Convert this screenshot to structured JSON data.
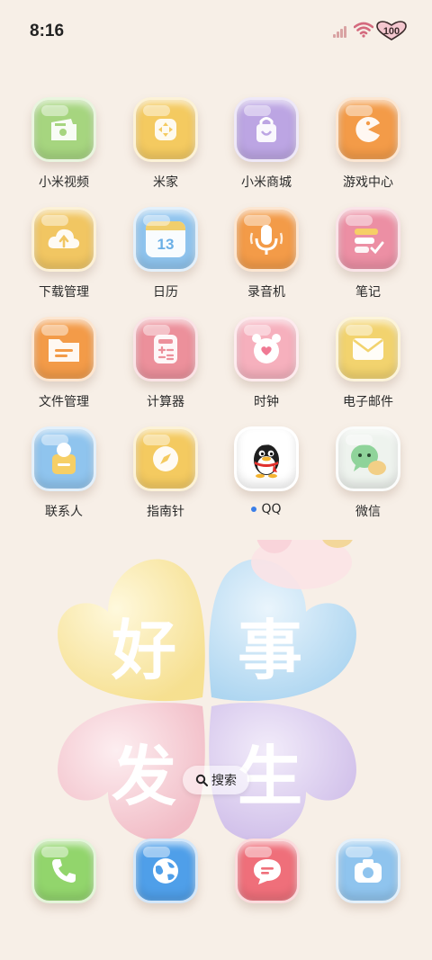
{
  "status": {
    "time": "8:16",
    "battery": "100"
  },
  "apps": [
    {
      "label": "小米视频",
      "icon": "video-icon",
      "color": "#9fd17a"
    },
    {
      "label": "米家",
      "icon": "home-hub-icon",
      "color": "#f3c75a"
    },
    {
      "label": "小米商城",
      "icon": "shopping-bag-icon",
      "color": "#b9a2e0"
    },
    {
      "label": "游戏中心",
      "icon": "game-pacman-icon",
      "color": "#f29a45"
    },
    {
      "label": "下载管理",
      "icon": "download-cloud-icon",
      "color": "#f0c560"
    },
    {
      "label": "日历",
      "icon": "calendar-icon",
      "color": "#8cc2ee",
      "calendar_day": "13"
    },
    {
      "label": "录音机",
      "icon": "microphone-icon",
      "color": "#f29a45"
    },
    {
      "label": "笔记",
      "icon": "notes-icon",
      "color": "#e98aa0"
    },
    {
      "label": "文件管理",
      "icon": "folder-icon",
      "color": "#f29a45"
    },
    {
      "label": "计算器",
      "icon": "calculator-icon",
      "color": "#ea8d98"
    },
    {
      "label": "时钟",
      "icon": "alarm-clock-icon",
      "color": "#f4a9b7"
    },
    {
      "label": "电子邮件",
      "icon": "mail-icon",
      "color": "#f1d16a"
    },
    {
      "label": "联系人",
      "icon": "contacts-icon",
      "color": "#8cc2ee"
    },
    {
      "label": "指南针",
      "icon": "compass-icon",
      "color": "#f3c75a"
    },
    {
      "label": "QQ",
      "icon": "qq-penguin-icon",
      "color": "#ffffff"
    },
    {
      "label": "微信",
      "icon": "wechat-icon",
      "color": "#eef3ee"
    }
  ],
  "wallpaper": {
    "chars": [
      "好",
      "事",
      "发",
      "生"
    ]
  },
  "search": {
    "label": "搜索"
  },
  "dock": [
    {
      "icon": "phone-icon",
      "color": "#8fd36a"
    },
    {
      "icon": "browser-globe-icon",
      "color": "#4e9fe8"
    },
    {
      "icon": "messages-icon",
      "color": "#ef6d78"
    },
    {
      "icon": "camera-icon",
      "color": "#8cc2ee"
    }
  ]
}
